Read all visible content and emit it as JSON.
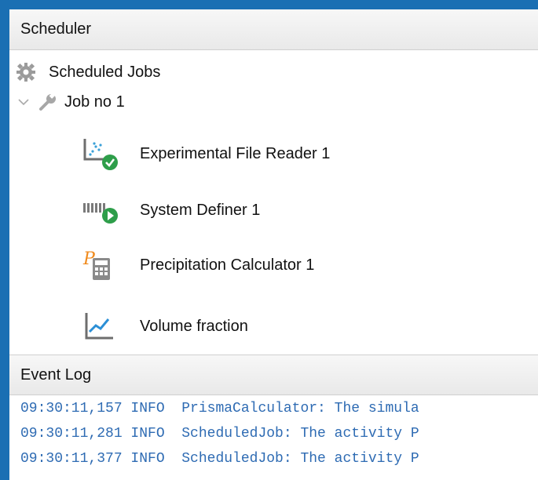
{
  "scheduler": {
    "title": "Scheduler",
    "root": {
      "label": "Scheduled Jobs",
      "icon": "gear-icon"
    },
    "job": {
      "label": "Job no 1",
      "icon": "wrench-icon",
      "expanded": true
    },
    "activities": [
      {
        "label": "Experimental File Reader 1",
        "icon": "scatter-plot-check-icon",
        "status": "success"
      },
      {
        "label": "System Definer 1",
        "icon": "table-play-icon",
        "status": "running"
      },
      {
        "label": "Precipitation Calculator 1",
        "icon": "calculator-icon"
      },
      {
        "label": "Volume fraction",
        "icon": "line-chart-icon"
      }
    ]
  },
  "event_log": {
    "title": "Event Log",
    "lines": [
      "09:30:11,157 INFO  PrismaCalculator: The simula",
      "09:30:11,281 INFO  ScheduledJob: The activity P",
      "09:30:11,377 INFO  ScheduledJob: The activity P"
    ]
  },
  "colors": {
    "border": "#1a6fb3",
    "log_text": "#2e6bb3",
    "success": "#2e9e4a",
    "accent_orange": "#f08a1c"
  }
}
